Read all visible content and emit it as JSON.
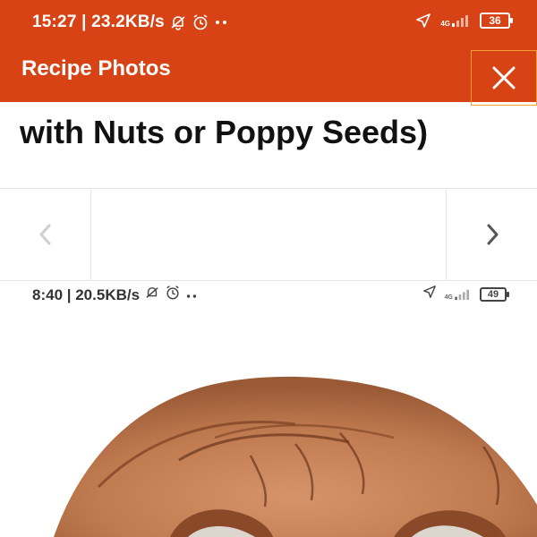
{
  "status_bar": {
    "time_speed": "15:27 | 23.2KB/s",
    "network": "4G",
    "battery": "36",
    "icons": [
      "bell-off-icon",
      "alarm-icon",
      "more-dots-icon",
      "location-arrow-icon",
      "signal-icon",
      "battery-icon"
    ]
  },
  "app_bar": {
    "title": "Recipe Photos",
    "close_icon": "close-icon"
  },
  "recipe": {
    "title_fragment": "with Nuts or Poppy Seeds)"
  },
  "carousel": {
    "prev_icon": "chevron-left-icon",
    "next_icon": "chevron-right-icon"
  },
  "photo": {
    "status_time_speed": "8:40 | 20.5KB/s",
    "status_network": "4G",
    "status_battery": "49"
  },
  "colors": {
    "accent": "#d84315",
    "close_outline": "#f0a030",
    "skin": "#c8855a"
  }
}
